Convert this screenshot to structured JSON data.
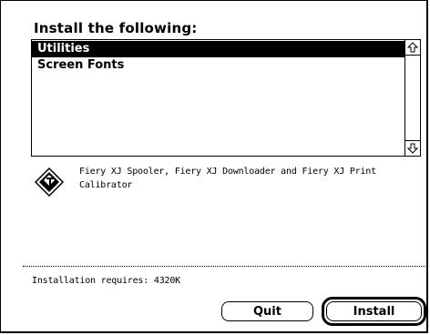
{
  "dialog": {
    "heading": "Install the following:",
    "list": {
      "items": [
        {
          "label": "Utilities",
          "selected": true
        },
        {
          "label": "Screen Fonts",
          "selected": false
        }
      ]
    },
    "description": "Fiery XJ Spooler, Fiery XJ Downloader and Fiery XJ Print Calibrator",
    "requirement": "Installation requires: 4320K",
    "buttons": {
      "quit_label": "Quit",
      "install_label": "Install"
    }
  }
}
